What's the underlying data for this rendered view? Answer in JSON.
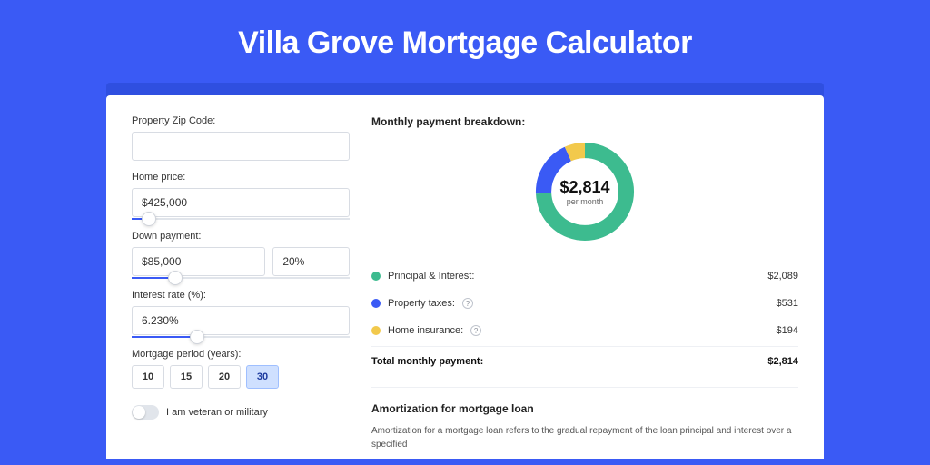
{
  "page": {
    "title": "Villa Grove Mortgage Calculator"
  },
  "form": {
    "zip": {
      "label": "Property Zip Code:",
      "value": ""
    },
    "homePrice": {
      "label": "Home price:",
      "value": "$425,000",
      "sliderPct": 8
    },
    "downPayment": {
      "label": "Down payment:",
      "amount": "$85,000",
      "pct": "20%",
      "sliderPct": 20
    },
    "interest": {
      "label": "Interest rate (%):",
      "value": "6.230%",
      "sliderPct": 30
    },
    "period": {
      "label": "Mortgage period (years):",
      "options": [
        "10",
        "15",
        "20",
        "30"
      ],
      "selected": "30"
    },
    "veteran": {
      "label": "I am veteran or military",
      "on": false
    }
  },
  "breakdown": {
    "title": "Monthly payment breakdown:",
    "centerAmount": "$2,814",
    "centerSub": "per month",
    "items": [
      {
        "label": "Principal & Interest:",
        "value": "$2,089",
        "color": "green",
        "pct": 74.2,
        "info": false
      },
      {
        "label": "Property taxes:",
        "value": "$531",
        "color": "blue",
        "pct": 18.9,
        "info": true
      },
      {
        "label": "Home insurance:",
        "value": "$194",
        "color": "yellow",
        "pct": 6.9,
        "info": true
      }
    ],
    "totalLabel": "Total monthly payment:",
    "totalValue": "$2,814"
  },
  "amortization": {
    "title": "Amortization for mortgage loan",
    "text": "Amortization for a mortgage loan refers to the gradual repayment of the loan principal and interest over a specified"
  },
  "chart_data": {
    "type": "pie",
    "title": "Monthly payment breakdown",
    "series": [
      {
        "name": "Principal & Interest",
        "value": 2089
      },
      {
        "name": "Property taxes",
        "value": 531
      },
      {
        "name": "Home insurance",
        "value": 194
      }
    ],
    "total": 2814,
    "unit": "USD per month"
  }
}
